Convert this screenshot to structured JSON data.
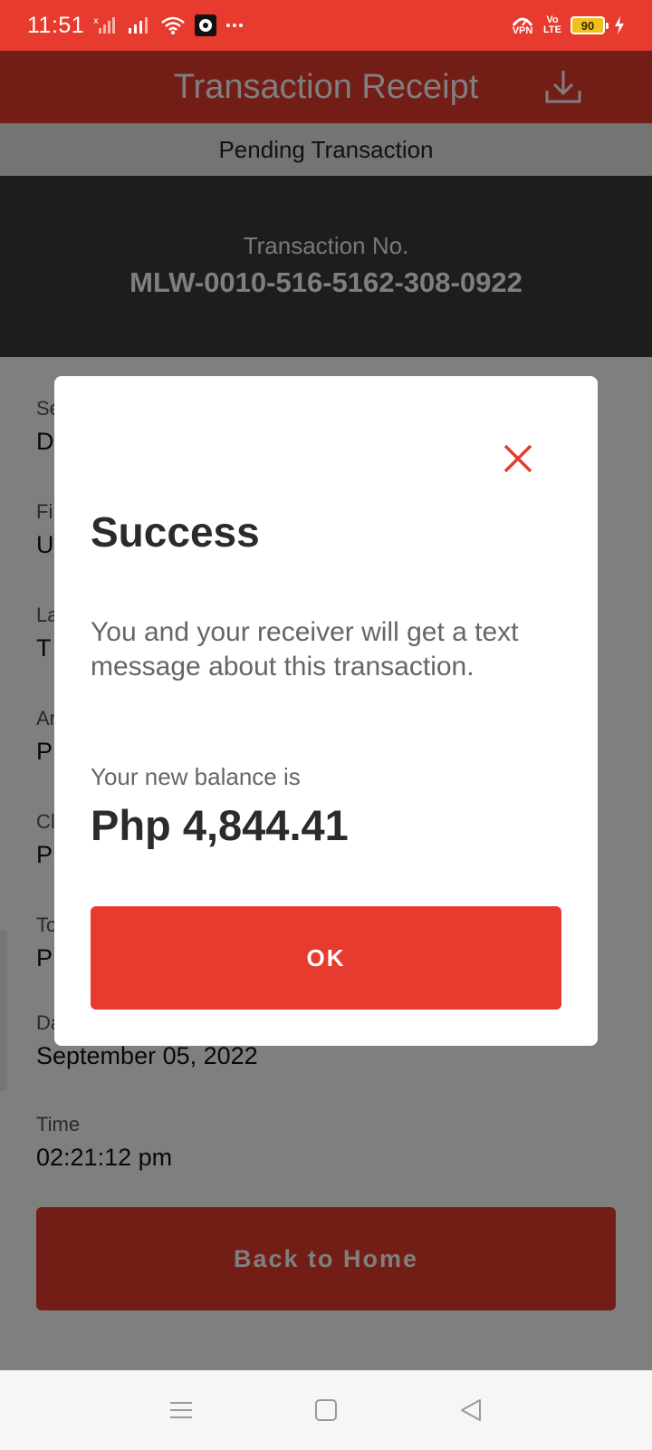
{
  "status_bar": {
    "time": "11:51",
    "vpn_label": "VPN",
    "volte_top": "Vo",
    "volte_bottom": "LTE",
    "battery_level": "90",
    "icons": [
      "signal-x-icon",
      "signal-icon",
      "wifi-icon",
      "app-notification-icon",
      "more-icon",
      "vpn-icon",
      "volte-icon",
      "battery-icon",
      "charging-icon"
    ]
  },
  "header": {
    "title": "Transaction Receipt",
    "download_icon": "download-icon"
  },
  "receipt": {
    "status": "Pending Transaction",
    "transaction_label": "Transaction No.",
    "transaction_number": "MLW-0010-516-5162-308-0922",
    "details": [
      {
        "label": "Se",
        "value": "D"
      },
      {
        "label": "Fi",
        "value": "U"
      },
      {
        "label": "La",
        "value": "T"
      },
      {
        "label": "Ar",
        "value": "P"
      },
      {
        "label": "Cl",
        "value": "P"
      },
      {
        "label": "To",
        "value": "P"
      },
      {
        "label": "Da",
        "value": "September 05, 2022"
      },
      {
        "label": "Time",
        "value": "02:21:12 pm"
      }
    ],
    "home_button": "Back to Home"
  },
  "dialog": {
    "title": "Success",
    "message": "You and your receiver will get a text message about this transaction.",
    "balance_label": "Your new balance is",
    "balance_value": "Php 4,844.41",
    "ok_button": "OK",
    "close_icon": "close-icon"
  },
  "nav_bar": {
    "icons": [
      "menu-icon",
      "home-square-icon",
      "back-triangle-icon"
    ]
  },
  "colors": {
    "brand_red": "#e63b2e",
    "dark_panel": "#3b3b3b",
    "overlay": "rgba(0,0,0,0.5)"
  }
}
